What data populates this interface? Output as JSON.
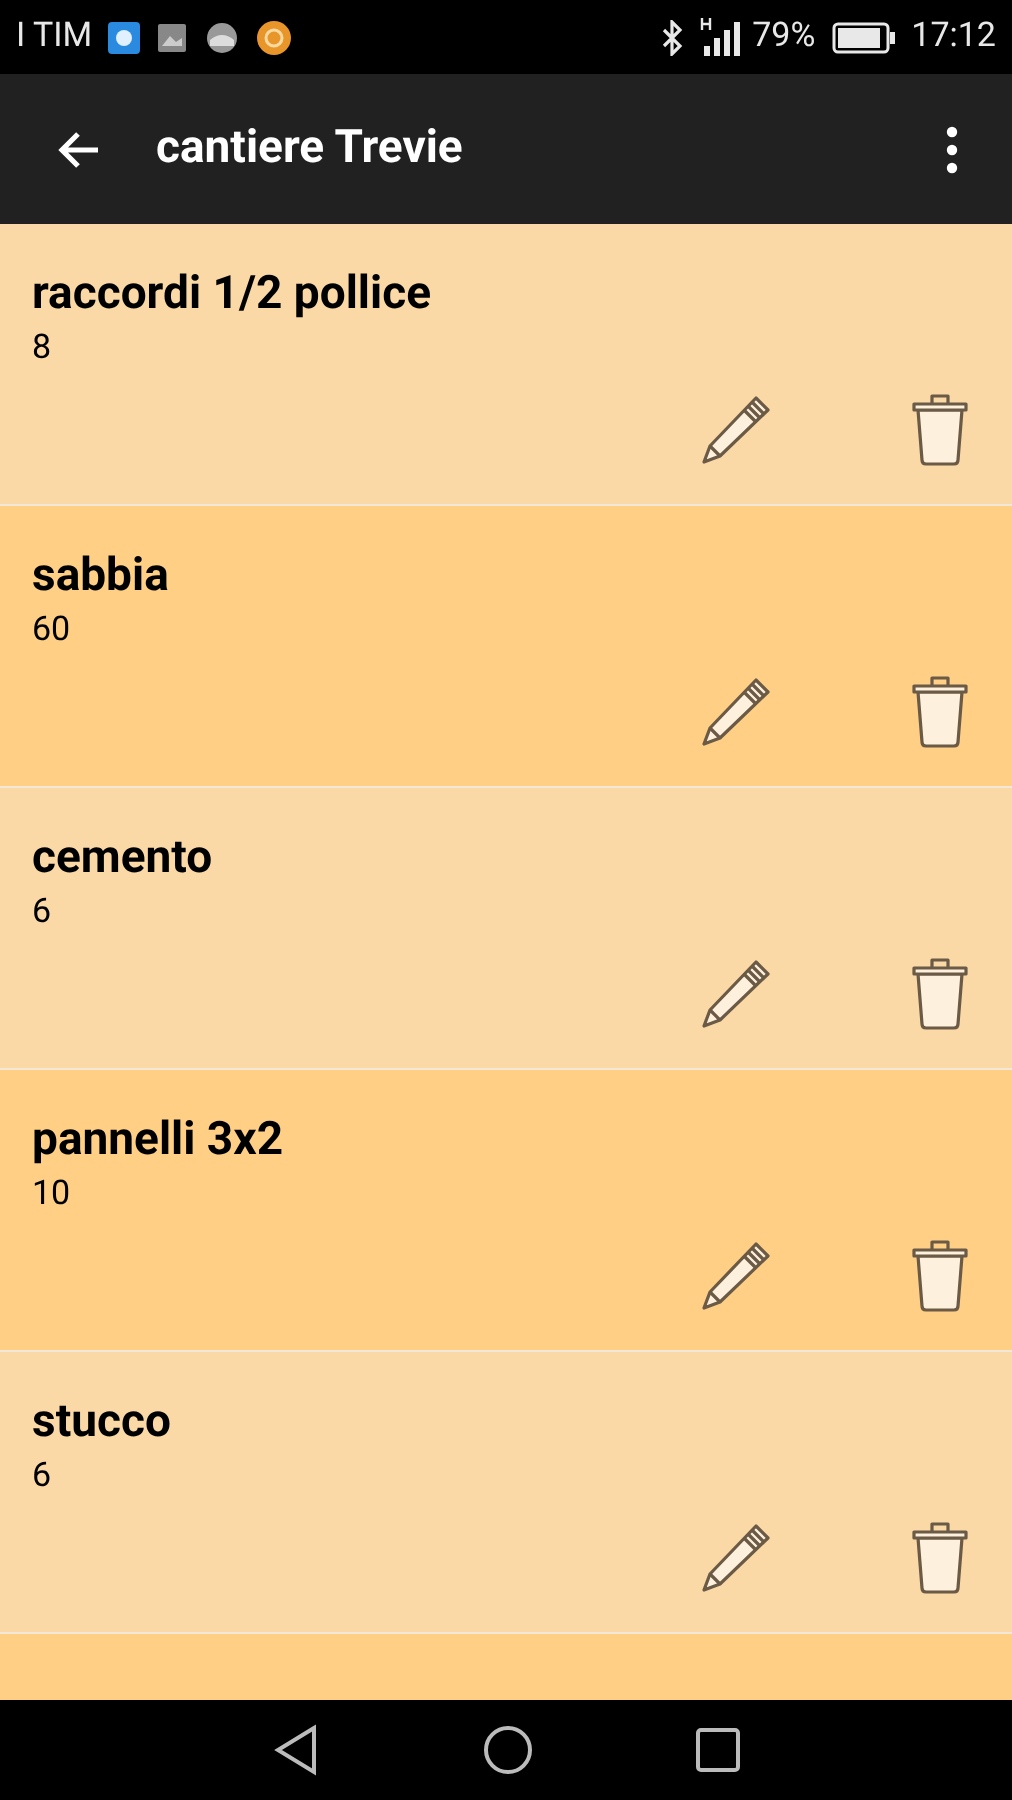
{
  "status_bar": {
    "carrier": "I TIM",
    "battery": "79%",
    "time": "17:12"
  },
  "app_bar": {
    "title": "cantiere Trevie"
  },
  "items": [
    {
      "name": "raccordi 1/2 pollice",
      "quantity": "8"
    },
    {
      "name": "sabbia",
      "quantity": "60"
    },
    {
      "name": "cemento",
      "quantity": "6"
    },
    {
      "name": "pannelli 3x2",
      "quantity": "10"
    },
    {
      "name": "stucco",
      "quantity": "6"
    }
  ]
}
